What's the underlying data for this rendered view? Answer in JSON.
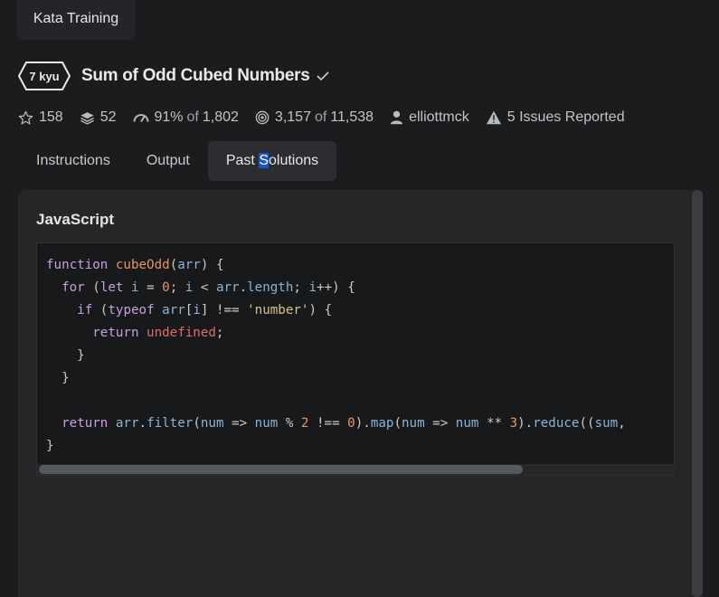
{
  "header": {
    "kata_training_label": "Kata Training"
  },
  "kata": {
    "rank": "7 kyu",
    "title": "Sum of Odd Cubed Numbers"
  },
  "stats": {
    "stars": "158",
    "collections": "52",
    "satisfaction_pct": "91%",
    "satisfaction_of": "of",
    "satisfaction_votes": "1,802",
    "completed": "3,157",
    "completed_of": "of",
    "attempted": "11,538",
    "author": "elliottmck",
    "issues": "5 Issues Reported"
  },
  "tabs": {
    "instructions": "Instructions",
    "output": "Output",
    "past_solutions_prefix": "Past ",
    "past_solutions_selected": "S",
    "past_solutions_suffix": "olutions",
    "active": "Past Solutions"
  },
  "solution": {
    "language": "JavaScript",
    "code_lines": [
      "function cubeOdd(arr) {",
      "  for (let i = 0; i < arr.length; i++) {",
      "    if (typeof arr[i] !== 'number') {",
      "      return undefined;",
      "    }",
      "  }",
      "",
      "  return arr.filter(num => num % 2 !== 0).map(num => num ** 3).reduce((sum,",
      "}"
    ]
  },
  "colors": {
    "keyword": "#c7a0e0",
    "function_name": "#e5955f",
    "variable": "#8ab4d6",
    "number": "#e5955f",
    "string": "#d6c28a",
    "selection": "#1a52c8"
  },
  "icons": [
    "star-icon",
    "layers-icon",
    "satisfaction-icon",
    "target-icon",
    "user-icon",
    "warning-icon",
    "check-icon"
  ]
}
